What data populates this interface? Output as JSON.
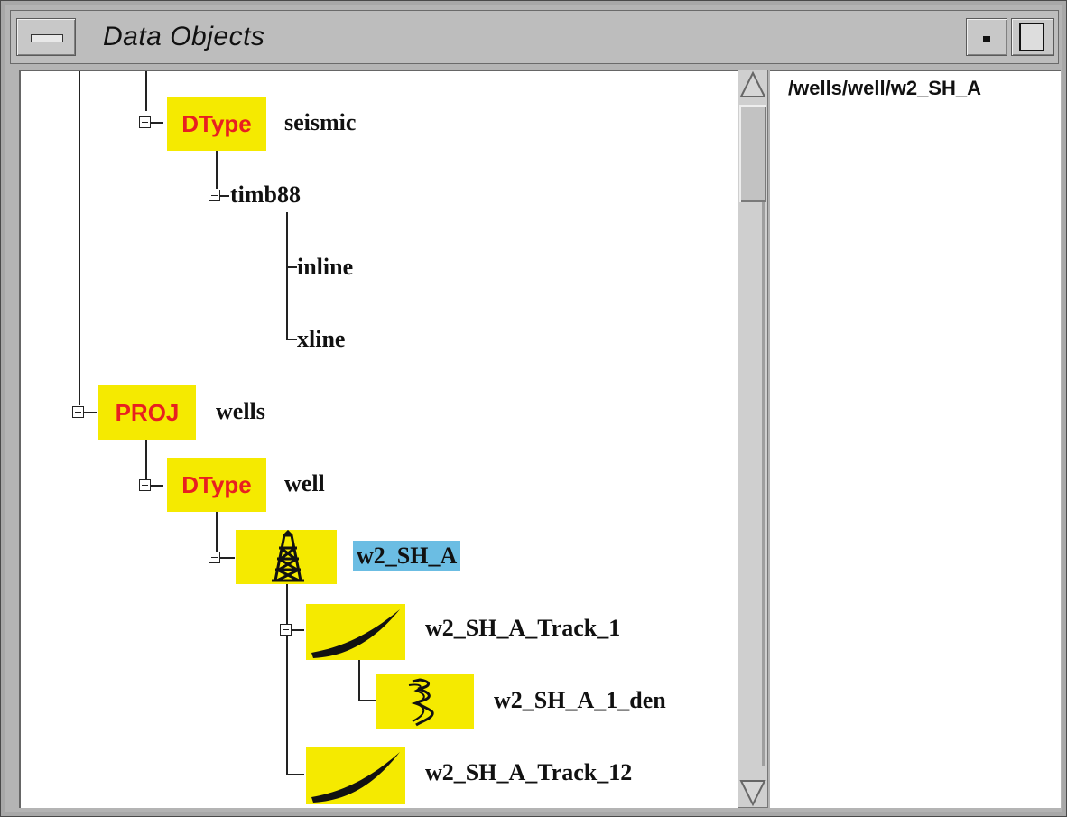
{
  "window": {
    "title": "Data Objects"
  },
  "detail": {
    "path": "/wells/well/w2_SH_A"
  },
  "tree": {
    "seismic": {
      "badge": "DType",
      "label": "seismic"
    },
    "timb88": {
      "label": "timb88"
    },
    "inline": {
      "label": "inline"
    },
    "xline": {
      "label": "xline"
    },
    "wells": {
      "badge": "PROJ",
      "label": "wells"
    },
    "well": {
      "badge": "DType",
      "label": "well"
    },
    "w2_sh_a": {
      "label": "w2_SH_A",
      "icon": "derrick-icon",
      "selected": true
    },
    "track_1": {
      "label": "w2_SH_A_Track_1",
      "icon": "well-track-icon"
    },
    "den": {
      "label": "w2_SH_A_1_den",
      "icon": "log-curve-icon"
    },
    "track_12": {
      "label": "w2_SH_A_Track_12",
      "icon": "well-track-icon"
    }
  }
}
